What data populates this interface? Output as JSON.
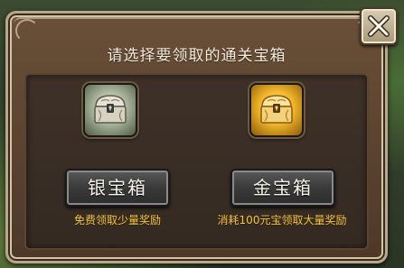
{
  "dialog": {
    "title": "请选择要领取的通关宝箱"
  },
  "chests": [
    {
      "icon": "silver-chest-icon",
      "button_label": "银宝箱",
      "description": "免费领取少量奖励",
      "glow_color": "#a8b49a"
    },
    {
      "icon": "gold-chest-icon",
      "button_label": "金宝箱",
      "description": "消耗100元宝领取大量奖励",
      "glow_color": "#f2b628"
    }
  ],
  "close_button": {
    "icon": "close-icon"
  },
  "colors": {
    "description_text": "#f2c43a",
    "title_text": "#f4ead8",
    "panel_bg": "#5a4230"
  }
}
